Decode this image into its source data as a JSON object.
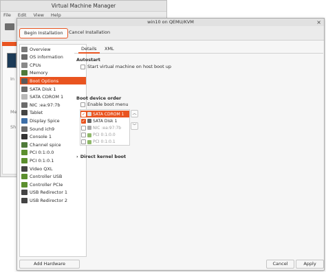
{
  "background_window": {
    "title": "Virtual Machine Manager",
    "menu": [
      "File",
      "Edit",
      "View",
      "Help"
    ],
    "fragments": [
      "In",
      "Me",
      "Sh"
    ]
  },
  "dialog": {
    "title": "win10 on QEMU/KVM",
    "close_glyph": "×",
    "toolbar": {
      "begin_label": "Begin Installation",
      "cancel_label": "Cancel Installation"
    }
  },
  "sidebar": {
    "items": [
      {
        "label": "Overview",
        "icon": "overview-icon",
        "color": "#7a7a7a"
      },
      {
        "label": "OS information",
        "icon": "os-info-icon",
        "color": "#6b6b6b"
      },
      {
        "label": "CPUs",
        "icon": "cpu-icon",
        "color": "#8a8a8a"
      },
      {
        "label": "Memory",
        "icon": "memory-icon",
        "color": "#4f7a3a"
      },
      {
        "label": "Boot Options",
        "icon": "boot-options-icon",
        "color": "#5a5a5a"
      },
      {
        "label": "SATA Disk 1",
        "icon": "disk-icon",
        "color": "#6b6b6b"
      },
      {
        "label": "SATA CDROM 1",
        "icon": "cdrom-icon",
        "color": "#b9b9b9"
      },
      {
        "label": "NIC :ea:97:7b",
        "icon": "nic-icon",
        "color": "#6b6b6b"
      },
      {
        "label": "Tablet",
        "icon": "tablet-icon",
        "color": "#444444"
      },
      {
        "label": "Display Spice",
        "icon": "display-icon",
        "color": "#3e6fa8"
      },
      {
        "label": "Sound ich9",
        "icon": "sound-icon",
        "color": "#6b6b6b"
      },
      {
        "label": "Console 1",
        "icon": "console-icon",
        "color": "#333333"
      },
      {
        "label": "Channel spice",
        "icon": "channel-icon",
        "color": "#4f7a3a"
      },
      {
        "label": "PCI 0:1:0.0",
        "icon": "pci-icon",
        "color": "#5b8f2e"
      },
      {
        "label": "PCI 0:1:0.1",
        "icon": "pci-icon",
        "color": "#5b8f2e"
      },
      {
        "label": "Video QXL",
        "icon": "video-icon",
        "color": "#444444"
      },
      {
        "label": "Controller USB",
        "icon": "controller-icon",
        "color": "#5b8f2e"
      },
      {
        "label": "Controller PCIe",
        "icon": "controller-icon",
        "color": "#5b8f2e"
      },
      {
        "label": "USB Redirector 1",
        "icon": "usb-icon",
        "color": "#444444"
      },
      {
        "label": "USB Redirector 2",
        "icon": "usb-icon",
        "color": "#444444"
      }
    ],
    "selected_index": 4,
    "add_hardware_label": "Add Hardware"
  },
  "tabs": {
    "details": "Details",
    "xml": "XML"
  },
  "autostart": {
    "heading": "Autostart",
    "checkbox_label": "Start virtual machine on host boot up",
    "checked": false
  },
  "boot": {
    "heading": "Boot device order",
    "enable_menu_label": "Enable boot menu",
    "enable_menu_checked": false,
    "devices": [
      {
        "label": "SATA CDROM 1",
        "checked": true,
        "selected": true,
        "disabled": false,
        "icon": "cdrom-icon",
        "color": "#dddddd"
      },
      {
        "label": "SATA Disk 1",
        "checked": true,
        "selected": false,
        "disabled": false,
        "icon": "disk-icon",
        "color": "#6b6b6b"
      },
      {
        "label": "NIC :ea:97:7b",
        "checked": false,
        "selected": false,
        "disabled": true,
        "icon": "nic-icon",
        "color": "#aaaaaa"
      },
      {
        "label": "PCI 0:1:0.0",
        "checked": false,
        "selected": false,
        "disabled": true,
        "icon": "pci-icon",
        "color": "#8fb86a"
      },
      {
        "label": "PCI 0:1:0.1",
        "checked": false,
        "selected": false,
        "disabled": true,
        "icon": "pci-icon",
        "color": "#8fb86a"
      }
    ],
    "up_glyph": "︿",
    "down_glyph": "﹀",
    "check_glyph": "✓"
  },
  "direct_kernel": {
    "arrow": "›",
    "label": "Direct kernel boot"
  },
  "footer": {
    "cancel_label": "Cancel",
    "apply_label": "Apply"
  },
  "colors": {
    "accent": "#e95420"
  }
}
